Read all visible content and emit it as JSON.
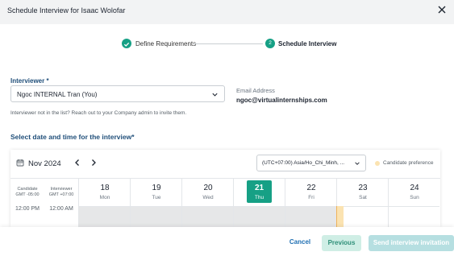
{
  "dialog": {
    "title": "Schedule Interview for Isaac Wolofar",
    "close_icon": "close-icon"
  },
  "stepper": {
    "steps": [
      {
        "label": "Define Requirements",
        "state": "completed"
      },
      {
        "label": "Schedule Interview",
        "number": "2",
        "state": "active"
      }
    ]
  },
  "interviewer": {
    "label": "Interviewer *",
    "selected": "Ngoc INTERNAL Tran (You)",
    "email_label": "Email Address",
    "email": "ngoc@virtualinternships.com",
    "help_text": "Interviewer not in the list? Reach out to your Company admin to invite them."
  },
  "schedule": {
    "title": "Select date and time for the interview*",
    "month": "Nov 2024",
    "timezone": "(UTC+07:00) Asia/Ho_Chi_Minh, ...",
    "candidate_pref_label": "Candidate preference",
    "candidate_tz": {
      "line1": "Candidate",
      "line2": "GMT -05:00",
      "time": "12:00 PM"
    },
    "interviewer_tz": {
      "line1": "Interviewer",
      "line2": "GMT +07:00",
      "time": "12:00 AM"
    },
    "days": [
      {
        "num": "18",
        "name": "Mon",
        "today": false,
        "past": true
      },
      {
        "num": "19",
        "name": "Tue",
        "today": false,
        "past": true
      },
      {
        "num": "20",
        "name": "Wed",
        "today": false,
        "past": true
      },
      {
        "num": "21",
        "name": "Thu",
        "today": true,
        "past": true
      },
      {
        "num": "22",
        "name": "Fri",
        "today": false,
        "past": true
      },
      {
        "num": "23",
        "name": "Sat",
        "today": false,
        "past": false
      },
      {
        "num": "24",
        "name": "Sun",
        "today": false,
        "past": false
      }
    ]
  },
  "footer": {
    "cancel": "Cancel",
    "previous": "Previous",
    "send": "Send interview invitation"
  },
  "colors": {
    "accent": "#16a085",
    "link": "#1f6fb2",
    "heading": "#1f4e79",
    "preference": "#fbe3b1"
  }
}
